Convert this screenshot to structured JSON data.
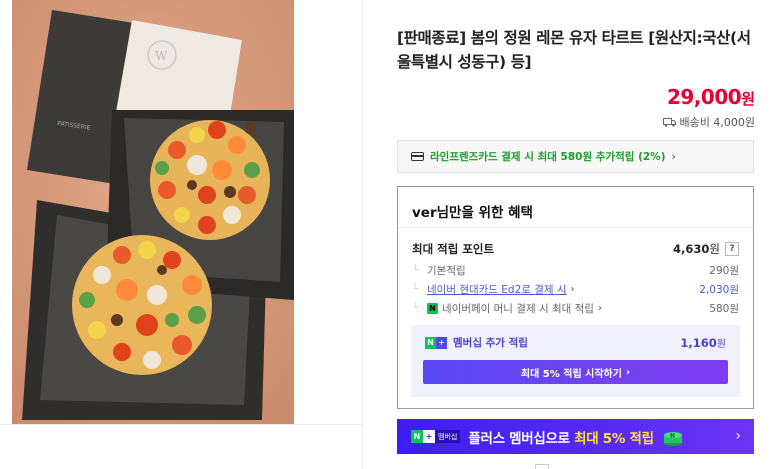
{
  "product": {
    "title": "[판매종료] 봄의 정원 레몬 유자 타르트 [원산지:국산(서울특별시 성동구) 등]",
    "price_number": "29,000",
    "price_unit": "원",
    "shipping": "배송비 4,000원",
    "box_logo_text": "W",
    "box_label_text": "PATISSERIE"
  },
  "card_banner": {
    "text": "라인프렌즈카드 결제 시 최대 580원 추가적립 (2%)",
    "chevron": "›"
  },
  "benefits": {
    "title": "ver님만을 위한 혜택",
    "max_label": "최대 적립 포인트",
    "max_value_number": "4,630",
    "max_value_unit": "원",
    "help_icon": "?",
    "rows": [
      {
        "label": "기본적립",
        "value": "290원"
      },
      {
        "label": "네이버 현대카드 Ed2로 결제 시",
        "value": "2,030원"
      },
      {
        "label": "네이버페이 머니 결제 시 최대 적립",
        "value": "580원"
      }
    ],
    "membership": {
      "label": "멤버십 추가 적립",
      "value_number": "1,160",
      "value_unit": "원",
      "button": "최대 5% 적립 시작하기",
      "button_chevron": "›"
    }
  },
  "plus_banner": {
    "tag_n": "N",
    "tag_plus": "+",
    "tag_member": "멤버십",
    "text_prefix": "플러스 멤버십으로 ",
    "text_highlight": "최대 5% 적립",
    "chevron": "›"
  },
  "colors": {
    "price_red": "#e60033",
    "naver_green": "#06c755",
    "membership_purple": "#4b3fd0"
  }
}
